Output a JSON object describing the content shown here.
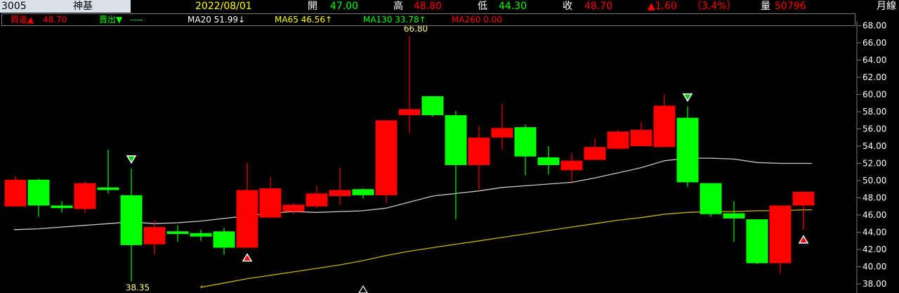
{
  "header": {
    "code": "3005",
    "name": "神基",
    "date": "2022/08/01",
    "open_label": "開",
    "open_value": "47.00",
    "high_label": "高",
    "high_value": "48.80",
    "low_label": "低",
    "low_value": "44.30",
    "close_label": "收",
    "close_value": "48.70",
    "change": "▲1.60",
    "change_pct": "（3.4%）",
    "volume_label": "量",
    "volume_value": "50796",
    "period": "月線"
  },
  "legend": {
    "buy_label": "買進▲",
    "buy_value": "48.70",
    "sell_label": "賣出▼",
    "sell_value": "----",
    "ma20": "MA20 51.99↓",
    "ma65": "MA65 46.56↑",
    "ma130": "MA130 33.78↑",
    "ma260": "MA260 0.00"
  },
  "colors": {
    "up": "#ff0000",
    "down": "#00ff00",
    "ma20": "#c8c8c8",
    "ma65": "#c8b400",
    "header_date": "#ffff00",
    "highlight_name_bg": "#d8e0e8"
  },
  "chart_data": {
    "type": "candlestick",
    "ylim": [
      37.4,
      68.4
    ],
    "yticks": [
      "38.00",
      "40.00",
      "42.00",
      "44.00",
      "46.00",
      "48.00",
      "50.00",
      "52.00",
      "54.00",
      "56.00",
      "58.00",
      "60.00",
      "62.00",
      "64.00",
      "66.00",
      "68.00"
    ],
    "candles": [
      {
        "o": 47.0,
        "h": 50.5,
        "l": 47.0,
        "c": 50.1
      },
      {
        "o": 50.1,
        "h": 50.2,
        "l": 45.8,
        "c": 47.1
      },
      {
        "o": 47.1,
        "h": 47.6,
        "l": 46.3,
        "c": 46.8
      },
      {
        "o": 46.7,
        "h": 49.9,
        "l": 46.2,
        "c": 49.7
      },
      {
        "o": 49.2,
        "h": 53.6,
        "l": 48.5,
        "c": 48.9
      },
      {
        "o": 48.3,
        "h": 51.4,
        "l": 38.3,
        "c": 42.5
      },
      {
        "o": 42.6,
        "h": 45.3,
        "l": 41.4,
        "c": 44.6
      },
      {
        "o": 44.1,
        "h": 44.8,
        "l": 42.9,
        "c": 43.8
      },
      {
        "o": 43.9,
        "h": 44.3,
        "l": 43.0,
        "c": 43.5
      },
      {
        "o": 44.1,
        "h": 44.5,
        "l": 41.4,
        "c": 42.2
      },
      {
        "o": 42.2,
        "h": 52.1,
        "l": 42.2,
        "c": 48.9
      },
      {
        "o": 45.7,
        "h": 50.4,
        "l": 45.7,
        "c": 49.1
      },
      {
        "o": 46.4,
        "h": 47.4,
        "l": 46.1,
        "c": 47.2
      },
      {
        "o": 47.0,
        "h": 49.4,
        "l": 46.8,
        "c": 48.5
      },
      {
        "o": 48.2,
        "h": 51.5,
        "l": 47.2,
        "c": 48.9
      },
      {
        "o": 49.0,
        "h": 49.1,
        "l": 47.9,
        "c": 48.3
      },
      {
        "o": 48.3,
        "h": 48.5,
        "l": 47.4,
        "c": 57.0
      },
      {
        "o": 57.6,
        "h": 66.8,
        "l": 55.5,
        "c": 58.3
      },
      {
        "o": 59.8,
        "h": 59.8,
        "l": 57.4,
        "c": 57.6
      },
      {
        "o": 57.6,
        "h": 58.1,
        "l": 45.5,
        "c": 51.8
      },
      {
        "o": 51.8,
        "h": 56.3,
        "l": 49.0,
        "c": 55.0
      },
      {
        "o": 55.0,
        "h": 58.9,
        "l": 53.6,
        "c": 56.1
      },
      {
        "o": 56.2,
        "h": 56.5,
        "l": 50.6,
        "c": 52.8
      },
      {
        "o": 52.7,
        "h": 54.0,
        "l": 50.7,
        "c": 51.8
      },
      {
        "o": 51.2,
        "h": 53.2,
        "l": 49.9,
        "c": 52.3
      },
      {
        "o": 52.4,
        "h": 54.9,
        "l": 52.4,
        "c": 53.9
      },
      {
        "o": 53.7,
        "h": 55.9,
        "l": 53.7,
        "c": 55.7
      },
      {
        "o": 54.0,
        "h": 56.8,
        "l": 54.0,
        "c": 55.9
      },
      {
        "o": 53.9,
        "h": 60.0,
        "l": 53.9,
        "c": 58.7
      },
      {
        "o": 57.3,
        "h": 58.6,
        "l": 49.3,
        "c": 49.8
      },
      {
        "o": 49.7,
        "h": 49.7,
        "l": 45.8,
        "c": 46.1
      },
      {
        "o": 46.2,
        "h": 47.6,
        "l": 42.9,
        "c": 45.6
      },
      {
        "o": 45.5,
        "h": 45.5,
        "l": 40.3,
        "c": 40.4
      },
      {
        "o": 40.4,
        "h": 47.1,
        "l": 39.2,
        "c": 47.1
      },
      {
        "o": 47.1,
        "h": 48.8,
        "l": 44.3,
        "c": 48.7
      }
    ],
    "ma20": [
      44.3,
      44.4,
      44.6,
      44.8,
      45.0,
      45.2,
      45.0,
      45.1,
      45.3,
      45.6,
      45.9,
      46.2,
      46.4,
      46.3,
      46.4,
      46.5,
      46.8,
      47.5,
      48.2,
      48.5,
      48.8,
      49.2,
      49.4,
      49.6,
      49.8,
      50.3,
      50.9,
      51.5,
      52.3,
      52.6,
      52.6,
      52.5,
      52.1,
      52.0,
      52.0
    ],
    "ma65": [
      null,
      null,
      null,
      null,
      null,
      null,
      null,
      null,
      37.6,
      38.1,
      38.6,
      39.0,
      39.4,
      39.8,
      40.2,
      40.7,
      41.3,
      41.8,
      42.2,
      42.6,
      43.0,
      43.4,
      43.8,
      44.2,
      44.6,
      45.0,
      45.4,
      45.7,
      46.1,
      46.3,
      46.4,
      46.4,
      46.5,
      46.5,
      46.6
    ],
    "annotations": [
      {
        "type": "sell-signal",
        "index": 5,
        "value": 51.4
      },
      {
        "type": "buy-signal",
        "index": 10,
        "value": 42.2
      },
      {
        "type": "sell-signal",
        "index": 29,
        "value": 58.6
      },
      {
        "type": "buy-signal",
        "index": 34,
        "value": 44.3
      },
      {
        "type": "marker",
        "index": 15,
        "value": 38.0
      }
    ],
    "labels": [
      {
        "text": "66.80",
        "index": 17,
        "value": 66.8
      },
      {
        "text": "38.35",
        "index": 5,
        "value": 38.3
      }
    ]
  }
}
